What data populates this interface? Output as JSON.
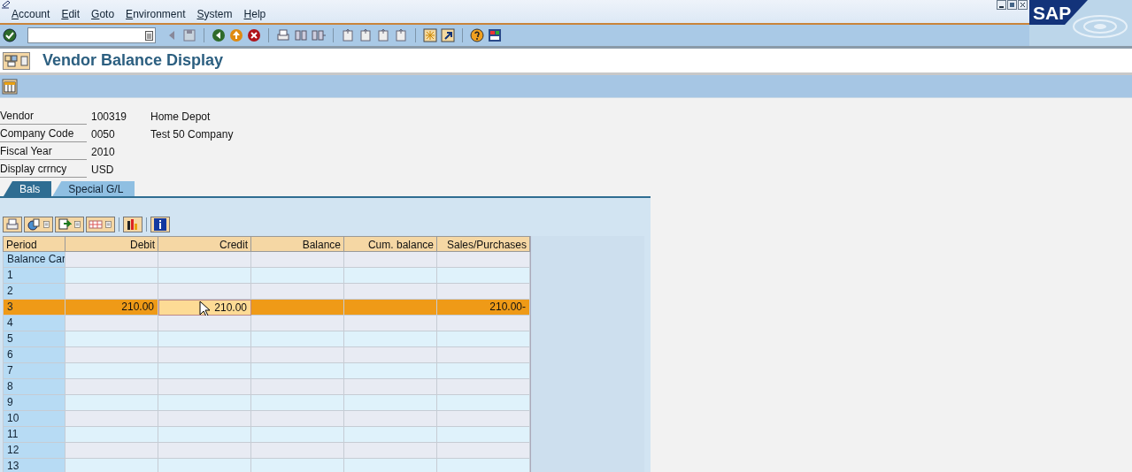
{
  "menu": [
    {
      "label": "Account"
    },
    {
      "label": "Edit"
    },
    {
      "label": "Goto"
    },
    {
      "label": "Environment"
    },
    {
      "label": "System"
    },
    {
      "label": "Help"
    }
  ],
  "logo": {
    "text": "SAP"
  },
  "title": "Vendor Balance Display",
  "header_fields": [
    {
      "label": "Vendor",
      "value": "100319",
      "description": "Home Depot"
    },
    {
      "label": "Company Code",
      "value": "0050",
      "description": "Test 50 Company"
    },
    {
      "label": "Fiscal Year",
      "value": "2010"
    },
    {
      "label": "Display crrncy",
      "value": "USD"
    }
  ],
  "tabs": [
    {
      "label": "Bals",
      "selected": true
    },
    {
      "label": "Special G/L",
      "selected": false
    }
  ],
  "table": {
    "columns": [
      "Period",
      "Debit",
      "Credit",
      "Balance",
      "Cum. balance",
      "Sales/Purchases"
    ],
    "rows": [
      {
        "cells": [
          "Balance Car",
          "",
          "",
          "",
          "",
          ""
        ],
        "selected": false,
        "focused": [
          false,
          false,
          false,
          false,
          false,
          false
        ]
      },
      {
        "cells": [
          "1",
          "",
          "",
          "",
          "",
          ""
        ],
        "selected": false,
        "focused": [
          false,
          false,
          false,
          false,
          false,
          false
        ]
      },
      {
        "cells": [
          "2",
          "",
          "",
          "",
          "",
          ""
        ],
        "selected": false,
        "focused": [
          false,
          false,
          false,
          false,
          false,
          false
        ]
      },
      {
        "cells": [
          "3",
          "210.00",
          "210.00",
          "",
          "",
          "210.00-"
        ],
        "selected": true,
        "focused": [
          false,
          false,
          true,
          false,
          false,
          false
        ]
      },
      {
        "cells": [
          "4",
          "",
          "",
          "",
          "",
          ""
        ],
        "selected": false,
        "focused": [
          false,
          false,
          false,
          false,
          false,
          false
        ]
      },
      {
        "cells": [
          "5",
          "",
          "",
          "",
          "",
          ""
        ],
        "selected": false,
        "focused": [
          false,
          false,
          false,
          false,
          false,
          false
        ]
      },
      {
        "cells": [
          "6",
          "",
          "",
          "",
          "",
          ""
        ],
        "selected": false,
        "focused": [
          false,
          false,
          false,
          false,
          false,
          false
        ]
      },
      {
        "cells": [
          "7",
          "",
          "",
          "",
          "",
          ""
        ],
        "selected": false,
        "focused": [
          false,
          false,
          false,
          false,
          false,
          false
        ]
      },
      {
        "cells": [
          "8",
          "",
          "",
          "",
          "",
          ""
        ],
        "selected": false,
        "focused": [
          false,
          false,
          false,
          false,
          false,
          false
        ]
      },
      {
        "cells": [
          "9",
          "",
          "",
          "",
          "",
          ""
        ],
        "selected": false,
        "focused": [
          false,
          false,
          false,
          false,
          false,
          false
        ]
      },
      {
        "cells": [
          "10",
          "",
          "",
          "",
          "",
          ""
        ],
        "selected": false,
        "focused": [
          false,
          false,
          false,
          false,
          false,
          false
        ]
      },
      {
        "cells": [
          "11",
          "",
          "",
          "",
          "",
          ""
        ],
        "selected": false,
        "focused": [
          false,
          false,
          false,
          false,
          false,
          false
        ]
      },
      {
        "cells": [
          "12",
          "",
          "",
          "",
          "",
          ""
        ],
        "selected": false,
        "focused": [
          false,
          false,
          false,
          false,
          false,
          false
        ]
      },
      {
        "cells": [
          "13",
          "",
          "",
          "",
          "",
          ""
        ],
        "selected": false,
        "focused": [
          false,
          false,
          false,
          false,
          false,
          false
        ]
      }
    ]
  }
}
